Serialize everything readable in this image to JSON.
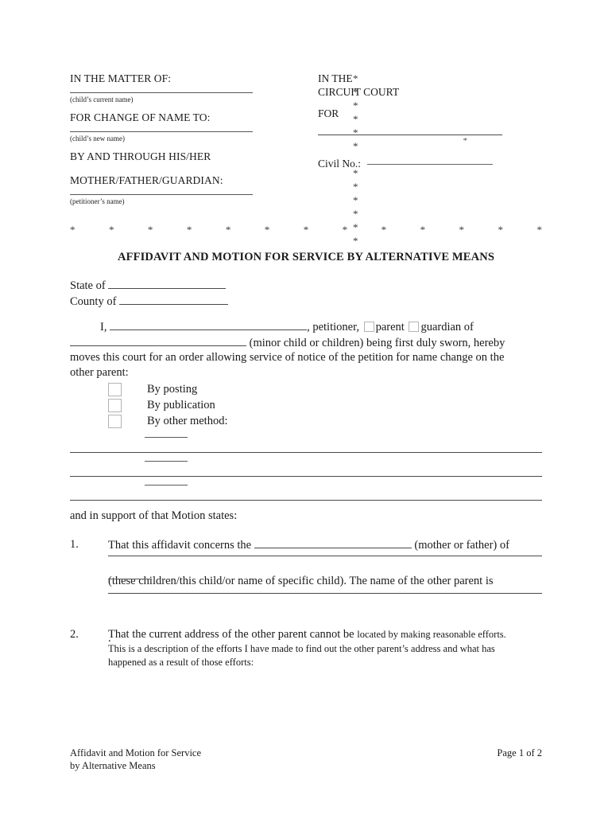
{
  "document": {
    "title": "AFFIDAVIT AND MOTION FOR SERVICE BY ALTERNATIVE MEANS"
  },
  "caption": {
    "left": {
      "line1": "IN THE MATTER OF:",
      "note1": "(child’s current name)",
      "line2": "FOR CHANGE OF NAME TO:",
      "note2": "(child’s new name)",
      "line3": "BY AND THROUGH HIS/HER",
      "line4": "MOTHER/FATHER/GUARDIAN:",
      "note3": "(petitioner’s name)"
    },
    "right": {
      "in_the": "IN THE",
      "circuit_court": "CIRCUIT COURT",
      "for": "FOR",
      "rule_star": "*",
      "civil_no_label": "Civil No.:"
    },
    "star": "*",
    "star_column": [
      "*",
      "*",
      "*",
      "*",
      "*",
      "*",
      "",
      "*",
      "*",
      "*",
      "*",
      "*",
      "*",
      "*"
    ],
    "star_rule": [
      "*",
      "*",
      "*",
      "*",
      "*",
      "*",
      "*",
      "*",
      "*",
      "*",
      "*",
      "*",
      "*"
    ]
  },
  "venue": {
    "state_label": "State of",
    "county_label": "County of"
  },
  "intro": {
    "i_label": "I,",
    "petitioner_label": ", petitioner,",
    "parent_label": "parent",
    "guardian_label": "guardian of",
    "minor_tail": "(minor child or children) being first duly sworn, hereby",
    "line3": "moves this court for an order allowing service of notice of the petition for name change on the",
    "line4": "other parent:"
  },
  "methods": [
    {
      "label": "By posting"
    },
    {
      "label": "By publication"
    },
    {
      "label": "By other method:"
    }
  ],
  "support_text": "and in support of that Motion states:",
  "items": [
    {
      "number": "1.",
      "text_a": "That this affidavit concerns the",
      "text_b": "(mother or father) of",
      "text_c": "(these children/this child/or name of specific child). The name of the other parent is",
      "text_d": "."
    },
    {
      "number": "2.",
      "text_a": "That the current address of the other parent cannot be",
      "text_b": "located by making reasonable efforts.",
      "text_c": "This is a description of the efforts I have made to find out the other parent’s address and what has",
      "text_d": "happened as a result of those efforts:"
    }
  ],
  "footer": {
    "left_line1": "Affidavit and Motion for Service",
    "left_line2": "by Alternative Means",
    "page": "Page 1 of 2"
  },
  "colors": {
    "text": "#1a1a1a",
    "rule": "#4a4a4a",
    "checkbox_border": "#b4b4b4",
    "background": "#ffffff"
  }
}
